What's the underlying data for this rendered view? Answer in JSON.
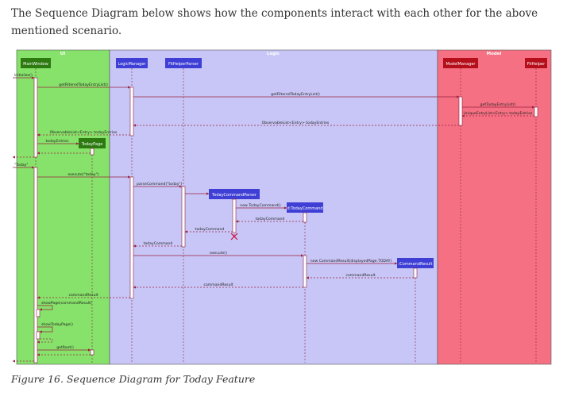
{
  "intro_text": "The Sequence Diagram below shows how the components interact with each other for the above mentioned scenario.",
  "caption": "Figure 16. Sequence Diagram for Today Feature",
  "colors": {
    "ui_bg": "#86e26a",
    "logic_bg": "#c8c6f6",
    "model_bg": "#f57082",
    "ui_box": "#2c7a10",
    "logic_box": "#3f3fd6",
    "model_box": "#b50f1c",
    "arrow": "#9a2040"
  },
  "diagram": {
    "frames": {
      "ui": "UI",
      "logic": "Logic",
      "model": "Model"
    },
    "participants": {
      "main_window": "MainWindow",
      "today_page": "TodayPage",
      "logic_manager": "LogicManager",
      "fithelper_parser": "FitHelperParser",
      "today_command_parser": "TodayCommandParser",
      "today_command": "d:TodayCommand",
      "command_result": ":CommandResult",
      "model_manager": "ModelManager",
      "fithelper": "FitHelper"
    },
    "messages": {
      "initialize": "initialize()",
      "get_filtered_today_1": "getFilteredTodayEntryList()",
      "get_filtered_today_2": "getFilteredTodayEntryList()",
      "get_today_entry_list": "getTodayEntryList()",
      "unique_entry_list": "UniqueEntryList<Entry> todayEntries",
      "observable_list_1": "ObservableList<Entry> todayEntries",
      "observable_list_2": "ObservableList<Entry> todayEntries",
      "today_entries": "todayEntries",
      "today_input": "\"Today\"",
      "execute_today": "execute(\"today\")",
      "parse_command": "parseCommand(\"today\")",
      "new_today_command": "new TodayCommand()",
      "today_command_1": "todayCommand",
      "today_command_2": "todayCommand",
      "today_command_3": "todayCommand",
      "execute": "execute()",
      "new_command_result": "new CommandResult(displayedPage.TODAY)",
      "command_result_1": "commandResult",
      "command_result_2": "commandResult",
      "command_result_3": "commandResult",
      "show_page": "showPage(commandResult)",
      "show_today_page": "showTodayPage()",
      "get_root": "getRoot()"
    }
  }
}
